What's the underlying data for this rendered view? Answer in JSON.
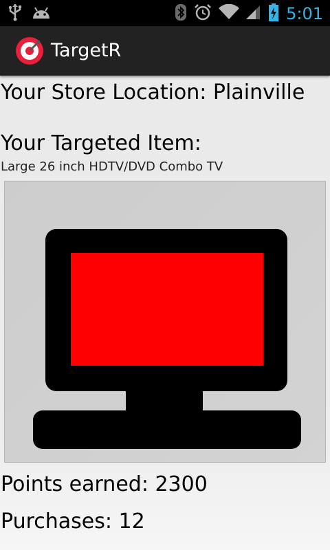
{
  "status_bar": {
    "time": "5:01",
    "left_icons": [
      "usb-icon",
      "android-debug-icon"
    ],
    "right_icons": [
      "bluetooth-icon",
      "alarm-icon",
      "wifi-icon",
      "signal-icon",
      "battery-icon"
    ],
    "accent_color": "#33b5e5"
  },
  "action_bar": {
    "title": "TargetR",
    "icon": "targetr-app-icon",
    "brand_color": "#e8203a"
  },
  "main": {
    "store_location": "Your Store Location: Plainville",
    "targeted_item_label": "Your Targeted Item:",
    "item_name": "Large 26 inch HDTV/DVD Combo TV",
    "item_image_icon": "tv-icon",
    "points_earned": "Points earned: 2300",
    "purchases": "Purchases: 12"
  }
}
